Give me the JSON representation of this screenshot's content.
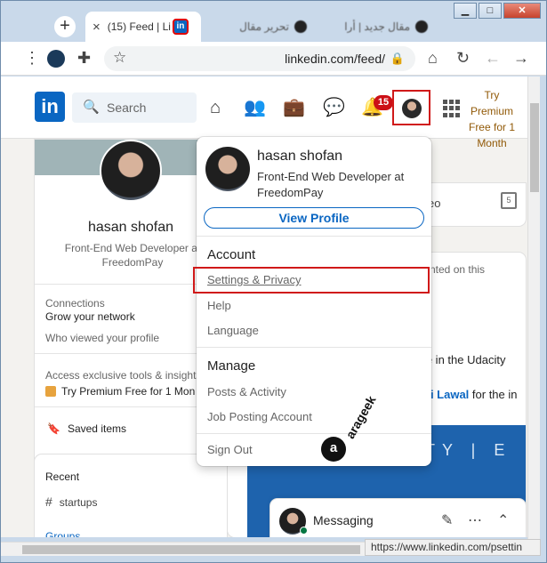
{
  "browser": {
    "active_tab_title": "(15) Feed | Li",
    "inactive_tab_1_title": "تحرير مقال",
    "inactive_tab_2_title": "مقال جديد | أرا",
    "url": "linkedin.com/feed/",
    "status_url": "https://www.linkedin.com/psettin",
    "new_tab_glyph": "+",
    "close_glyph": "×"
  },
  "nav": {
    "search_placeholder": "Search",
    "notification_count": "15",
    "premium_cta": "Try Premium Free for 1 Month",
    "logo_text": "in"
  },
  "profile_card": {
    "name": "hasan shofan",
    "headline": "Front-End Web Developer at FreedomPay",
    "connections_label": "Connections",
    "connections_sub": "Grow your network",
    "who_viewed": "Who viewed your profile",
    "access_tools": "Access exclusive tools & insights",
    "try_premium": "Try Premium Free for 1 Mon",
    "saved_items": "Saved items"
  },
  "recent_card": {
    "recent_label": "Recent",
    "startups": "startups",
    "groups": "Groups"
  },
  "dropdown": {
    "name": "hasan shofan",
    "headline": "Front-End Web Developer at FreedomPay",
    "view_profile": "View Profile",
    "account_header": "Account",
    "settings_privacy": "Settings & Privacy",
    "help": "Help",
    "language": "Language",
    "manage_header": "Manage",
    "posts_activity": "Posts & Activity",
    "job_posting": "Job Posting Account",
    "sign_out": "Sign Out"
  },
  "feed": {
    "video_partial": "eo",
    "calendar_day": "5",
    "commented_partial": "nted on this",
    "udacity_partial": "ate in the Udacity",
    "lawal_name": "ni Lawal",
    "lawal_rest": " for the in",
    "banner_text": "TY | E"
  },
  "messaging": {
    "title": "Messaging"
  },
  "watermark": {
    "brand_arabic": "arageek",
    "brand_letter": "a"
  }
}
